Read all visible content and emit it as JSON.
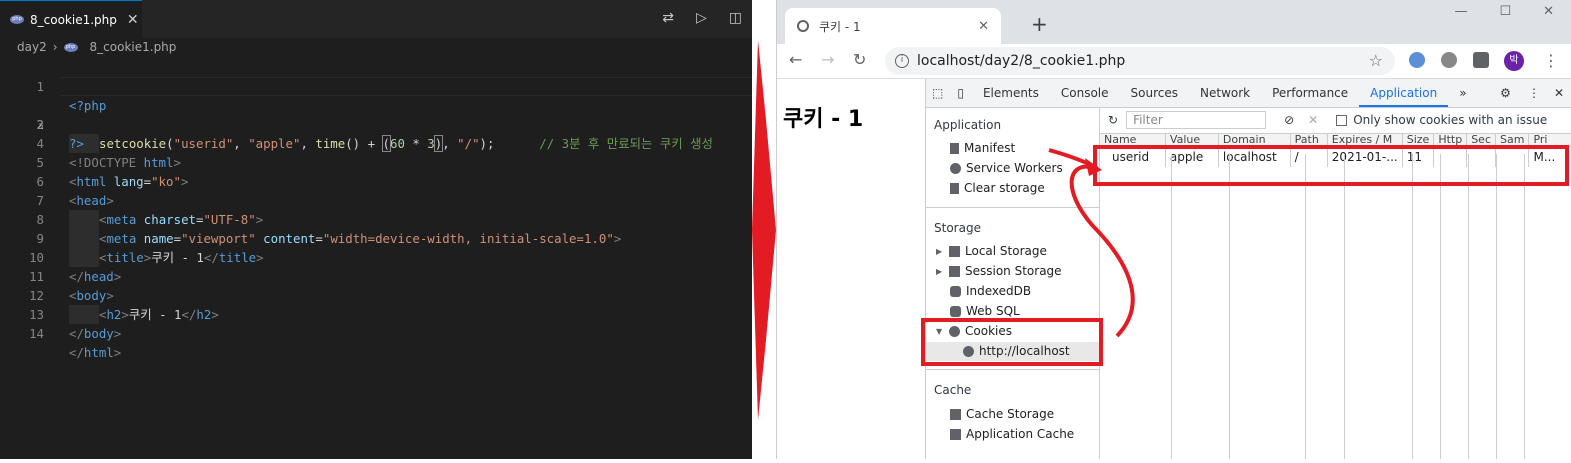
{
  "editor": {
    "tab": {
      "filename": "8_cookie1.php",
      "close": "✕"
    },
    "breadcrumb": {
      "folder": "day2",
      "file": "8_cookie1.php"
    },
    "lines": [
      {
        "num": "1"
      },
      {
        "num": "2"
      },
      {
        "num": "3"
      },
      {
        "num": "4"
      },
      {
        "num": "5"
      },
      {
        "num": "6"
      },
      {
        "num": "7"
      },
      {
        "num": "8"
      },
      {
        "num": "9"
      },
      {
        "num": "10"
      },
      {
        "num": "11"
      },
      {
        "num": "12"
      },
      {
        "num": "13"
      },
      {
        "num": "14"
      }
    ],
    "tokens": {
      "php_open": "<?php",
      "setcookie": "setcookie",
      "l2a": "(",
      "userid": "\"userid\"",
      "comma": ", ",
      "apple": "\"apple\"",
      "time": "time",
      "l2b": "() + ",
      "paren_open": "(",
      "sixty": "60",
      "mul": " * ",
      "three": "3",
      "paren_close": ")",
      "slash": "\"/\"",
      "l2end": ");",
      "comment": "// 3분 후 만료되는 쿠키 생성",
      "php_close": "?>",
      "doctype_a": "<!DOCTYPE ",
      "doctype_b": "html",
      "doctype_c": ">",
      "lt": "<",
      "gt": ">",
      "lt_slash": "</",
      "html": "html",
      "lang_attr": " lang",
      "eq": "=",
      "ko": "\"ko\"",
      "head": "head",
      "meta": "meta",
      "charset_attr": " charset",
      "utf8": "\"UTF-8\"",
      "name_attr": " name",
      "viewport": "\"viewport\"",
      "content_attr": " content",
      "content_val": "\"width=device-width, initial-scale=1.0\"",
      "title": "title",
      "title_text": "쿠키 - 1",
      "body": "body",
      "h2": "h2",
      "h2_text": "쿠키 - 1"
    }
  },
  "browser": {
    "tab_title": "쿠키 - 1",
    "tab_close": "✕",
    "new_tab": "+",
    "url": "localhost/day2/8_cookie1.php",
    "avatar_initial": "박",
    "page_heading": "쿠키 - 1",
    "win_controls": {
      "minimize": "—",
      "maximize": "☐",
      "close": "✕"
    }
  },
  "devtools": {
    "tabs": [
      "Elements",
      "Console",
      "Sources",
      "Network",
      "Performance",
      "Application"
    ],
    "more": "»",
    "close": "✕",
    "sidebar": {
      "application_header": "Application",
      "manifest": "Manifest",
      "service_workers": "Service Workers",
      "clear_storage": "Clear storage",
      "storage_header": "Storage",
      "local_storage": "Local Storage",
      "session_storage": "Session Storage",
      "indexeddb": "IndexedDB",
      "web_sql": "Web SQL",
      "cookies": "Cookies",
      "cookie_origin": "http://localhost",
      "cache_header": "Cache",
      "cache_storage": "Cache Storage",
      "application_cache": "Application Cache"
    },
    "cookies_panel": {
      "filter_placeholder": "Filter",
      "only_issue_label": "Only show cookies with an issue",
      "columns": [
        "Name",
        "Value",
        "Domain",
        "Path",
        "Expires / M",
        "Size",
        "Http",
        "Sec",
        "Sam",
        "Pri"
      ],
      "row": [
        "userid",
        "apple",
        "localhost",
        "/",
        "2021-01-...",
        "11",
        "",
        "",
        "",
        "M..."
      ]
    }
  },
  "colors": {
    "annotation_red": "#e31b23",
    "accent_blue": "#1a73e8",
    "editor_bg": "#1e1e1e"
  }
}
